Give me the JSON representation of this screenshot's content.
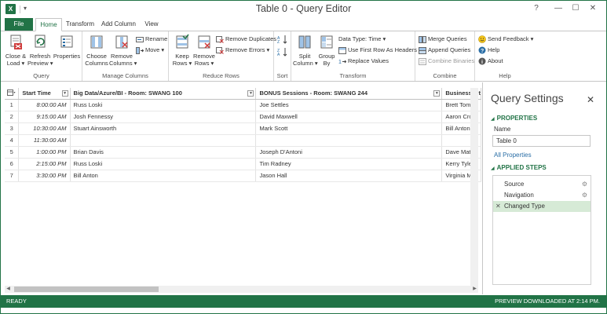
{
  "window": {
    "title": "Table 0 - Query Editor",
    "app_icon": "excel-icon",
    "quick_access": "▾",
    "controls": {
      "help": "?",
      "minimize": "—",
      "maximize": "☐",
      "close": "✕"
    }
  },
  "tabs": {
    "file": "File",
    "items": [
      {
        "label": "Home",
        "active": true
      },
      {
        "label": "Transform",
        "active": false
      },
      {
        "label": "Add Column",
        "active": false
      },
      {
        "label": "View",
        "active": false
      }
    ]
  },
  "ribbon": {
    "query": {
      "label": "Query",
      "close_load": [
        "Close &",
        "Load ▾"
      ],
      "refresh_preview": [
        "Refresh",
        "Preview ▾"
      ],
      "properties": "Properties"
    },
    "manage_columns": {
      "label": "Manage Columns",
      "choose_columns": [
        "Choose",
        "Columns"
      ],
      "remove_columns": [
        "Remove",
        "Columns ▾"
      ],
      "rename": "Rename",
      "move": "Move ▾"
    },
    "reduce_rows": {
      "label": "Reduce Rows",
      "keep_rows": [
        "Keep",
        "Rows ▾"
      ],
      "remove_rows": [
        "Remove",
        "Rows ▾"
      ],
      "remove_duplicates": "Remove Duplicates",
      "remove_errors": "Remove Errors ▾"
    },
    "sort": {
      "label": "Sort"
    },
    "transform": {
      "label": "Transform",
      "split_column": [
        "Split",
        "Column ▾"
      ],
      "group_by": [
        "Group",
        "By"
      ],
      "data_type": "Data Type: Time ▾",
      "first_row_headers": "Use First Row As Headers",
      "replace_values": "Replace Values"
    },
    "combine": {
      "label": "Combine",
      "merge_queries": "Merge Queries",
      "append_queries": "Append Queries",
      "combine_binaries": "Combine Binaries"
    },
    "help": {
      "label": "Help",
      "send_feedback": "Send Feedback ▾",
      "help": "Help",
      "about": "About"
    }
  },
  "grid": {
    "columns": [
      "Start Time",
      "Big Data/Azure/BI - Room: SWANG 100",
      "BONUS Sessions - Room: SWANG 244",
      "Business Int"
    ],
    "rows": [
      {
        "num": "1",
        "cells": [
          "8:00:00 AM",
          "Russ Loski",
          "Joe Settles",
          "Brett Tomso"
        ]
      },
      {
        "num": "2",
        "cells": [
          "9:15:00 AM",
          "Josh Fennessy",
          "David Maxwell",
          "Aaron Crou"
        ]
      },
      {
        "num": "3",
        "cells": [
          "10:30:00 AM",
          "Stuart Ainsworth",
          "Mark Scott",
          "Bill Anton"
        ]
      },
      {
        "num": "4",
        "cells": [
          "11:30:00 AM",
          "",
          "",
          ""
        ]
      },
      {
        "num": "5",
        "cells": [
          "1:00:00 PM",
          "Brian Davis",
          "Joseph D'Antoni",
          "Dave Mattin"
        ]
      },
      {
        "num": "6",
        "cells": [
          "2:15:00 PM",
          "Russ Loski",
          "Tim Radney",
          "Kerry Tyler"
        ]
      },
      {
        "num": "7",
        "cells": [
          "3:30:00 PM",
          "Bill Anton",
          "Jason Hall",
          "Virginia Mu"
        ]
      }
    ]
  },
  "query_settings": {
    "title": "Query Settings",
    "close": "✕",
    "properties_header": "PROPERTIES",
    "name_label": "Name",
    "name_value": "Table 0",
    "all_properties": "All Properties",
    "applied_steps_header": "APPLIED STEPS",
    "steps": [
      {
        "label": "Source",
        "selected": false,
        "gear": true
      },
      {
        "label": "Navigation",
        "selected": false,
        "gear": true
      },
      {
        "label": "Changed Type",
        "selected": true,
        "gear": false
      }
    ]
  },
  "status": {
    "left": "READY",
    "right": "PREVIEW DOWNLOADED AT 2:14 PM."
  },
  "colors": {
    "accent": "#217346",
    "selected_step": "#d6ead6",
    "link": "#2a6ea6"
  }
}
